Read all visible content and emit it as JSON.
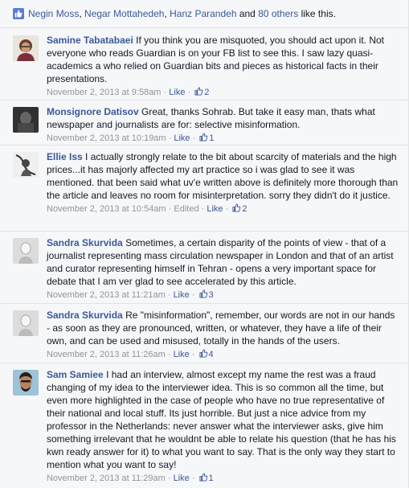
{
  "likes_bar": {
    "names": [
      "Negin Moss",
      "Negar Mottahedeh",
      "Hanz Parandeh"
    ],
    "others": "80 others",
    "suffix": "like this.",
    "sep1": ", ",
    "sep2": ", ",
    "and": " and ",
    "space": " "
  },
  "comments": [
    {
      "author": "Samine Tabatabaei",
      "text": "If you think you are misquoted, you should act upon it. Not everyone who reads Guardian is on your FB list to see this. I saw lazy quasi-academics a who relied on Guardian bits and pieces as historical facts in their presentations.",
      "time": "November 2, 2013 at 9:58am",
      "edited": "",
      "like": "Like",
      "likes": "2"
    },
    {
      "author": "Monsignore Datisov",
      "text": "Great, thanks Sohrab. But take it easy man, thats what newspaper and journalists are for: selective misinformation.",
      "time": "November 2, 2013 at 10:19am",
      "edited": "",
      "like": "Like",
      "likes": "1"
    },
    {
      "author": "Ellie Iss",
      "text": "I actually strongly relate to the bit about scarcity of materials and the high prices...it has majorly affected my art practice so i was glad to see it was mentioned. that been said what uv'e written above is definitely more thorough than the article and leaves no room for misinterpretation. sorry they didn't do it justice.",
      "time": "November 2, 2013 at 10:54am",
      "edited": "Edited",
      "like": "Like",
      "likes": "2"
    },
    {
      "author": "Sandra Skurvida",
      "text": "Sometimes, a certain disparity of the points of view - that of a journalist representing mass circulation newspaper in London and that of an artist and curator representing himself in Tehran - opens a very important space for debate that I am ver glad to see accelerated by this article.",
      "time": "November 2, 2013 at 11:21am",
      "edited": "",
      "like": "Like",
      "likes": "3"
    },
    {
      "author": "Sandra Skurvida",
      "text": "Re \"misinformation\", remember, our words are not in our hands - as soon as they are pronounced, written, or whatever, they have a life of their own, and can be used and misused, totally in the hands of the users.",
      "time": "November 2, 2013 at 11:26am",
      "edited": "",
      "like": "Like",
      "likes": "4"
    },
    {
      "author": "Sam Samiee",
      "text": "I had an interview, almost except my name the rest was a fraud changing of my idea to the interviewer idea. This is so common all the time, but even more highlighted in the case of people who have no true representative of their national and local stuff. Its just horrible. But just a nice advice from my professor in the Netherlands: never answer what the interviewer asks, give him something irrelevant that he wouldnt be able to relate his question (that he has his kwn ready answer for it) to what you want to say. That is the only way they start to mention what you want to say!",
      "time": "November 2, 2013 at 11:29am",
      "edited": "",
      "like": "Like",
      "likes": "1"
    }
  ],
  "sep": " · ",
  "colors": {
    "link": "#3b5998",
    "meta": "#90949c",
    "bg": "#f6f7f9",
    "border": "#e1e2e3"
  },
  "icons": {
    "like_bar": "thumbs-up-icon",
    "like_count": "thumbs-up-outline-icon"
  }
}
